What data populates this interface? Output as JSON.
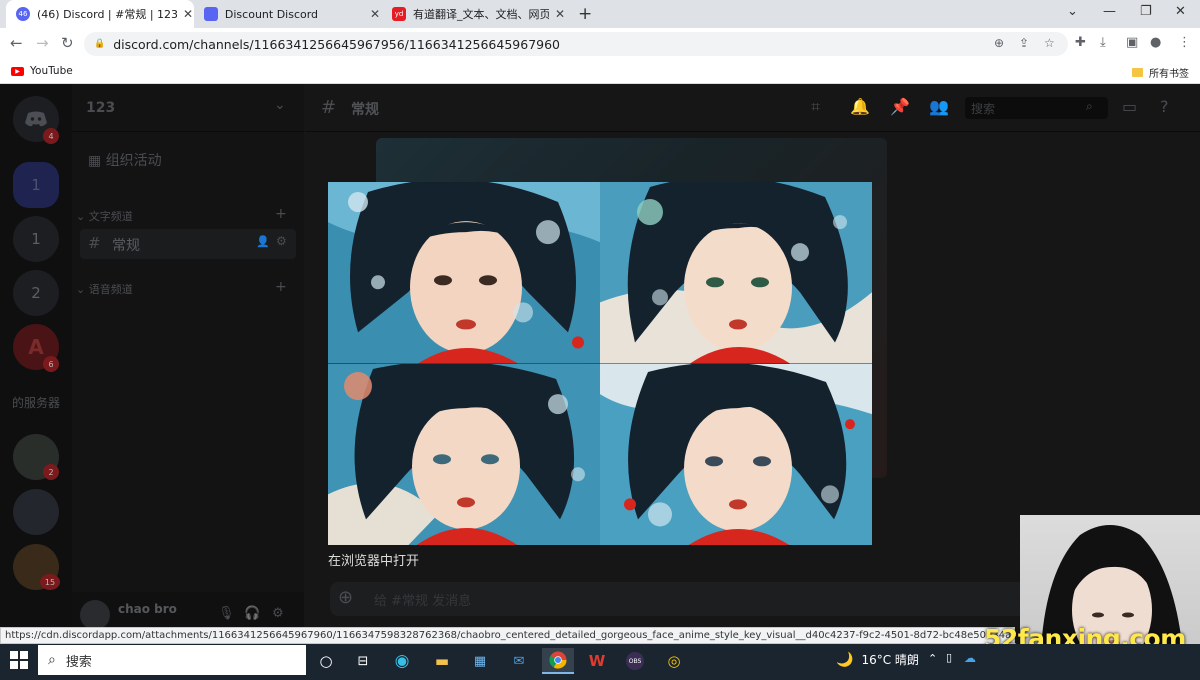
{
  "browser": {
    "tabs": [
      {
        "label": "(46) Discord | #常规 | 123",
        "icon_text": "46",
        "icon_color": "#5865f2",
        "active": true
      },
      {
        "label": "Discount Discord",
        "icon_text": "",
        "icon_color": "#5865f2",
        "active": false
      },
      {
        "label": "有道翻译_文本、文档、网页、在",
        "icon_text": "yd",
        "icon_color": "#e51c23",
        "active": false
      }
    ],
    "url": "discord.com/channels/1166341256645967956/1166341256645967960",
    "bookmarks": [
      {
        "label": "YouTube"
      }
    ],
    "all_bookmarks_label": "所有书签"
  },
  "discord": {
    "server_name": "123",
    "events_label": "组织活动",
    "text_category": "文字频道",
    "text_channel": "常规",
    "voice_category": "语音频道",
    "header_channel": "常规",
    "search_placeholder": "搜索",
    "servers_label": "的服务器",
    "guilds": [
      {
        "label": "",
        "badge": "4"
      },
      {
        "label": "1",
        "badge": ""
      },
      {
        "label": "1",
        "badge": ""
      },
      {
        "label": "2",
        "badge": ""
      },
      {
        "label": "",
        "badge": "6"
      }
    ],
    "more_guild_badges": [
      "2",
      "15"
    ],
    "message_placeholder": "给 #常规 发消息",
    "username": "chao bro"
  },
  "lightbox": {
    "open_in_browser": "在浏览器中打开"
  },
  "status_url": "https://cdn.discordapp.com/attachments/1166341256645967960/1166347598328762368/chaobro_centered_detailed_gorgeous_face_anime_style_key_visual__d40c4237-f9c2-4501-8d72-bc48e50534ac.png?ex=654a28d9...",
  "taskbar": {
    "search_label": "搜索",
    "weather": "16°C 晴朗"
  },
  "watermark": "52fanxing.com",
  "colors": {
    "discord_bg": "#161617",
    "chrome_tabstrip": "#dee1e6",
    "taskbar": "#1b2530",
    "accent": "#5865f2"
  }
}
